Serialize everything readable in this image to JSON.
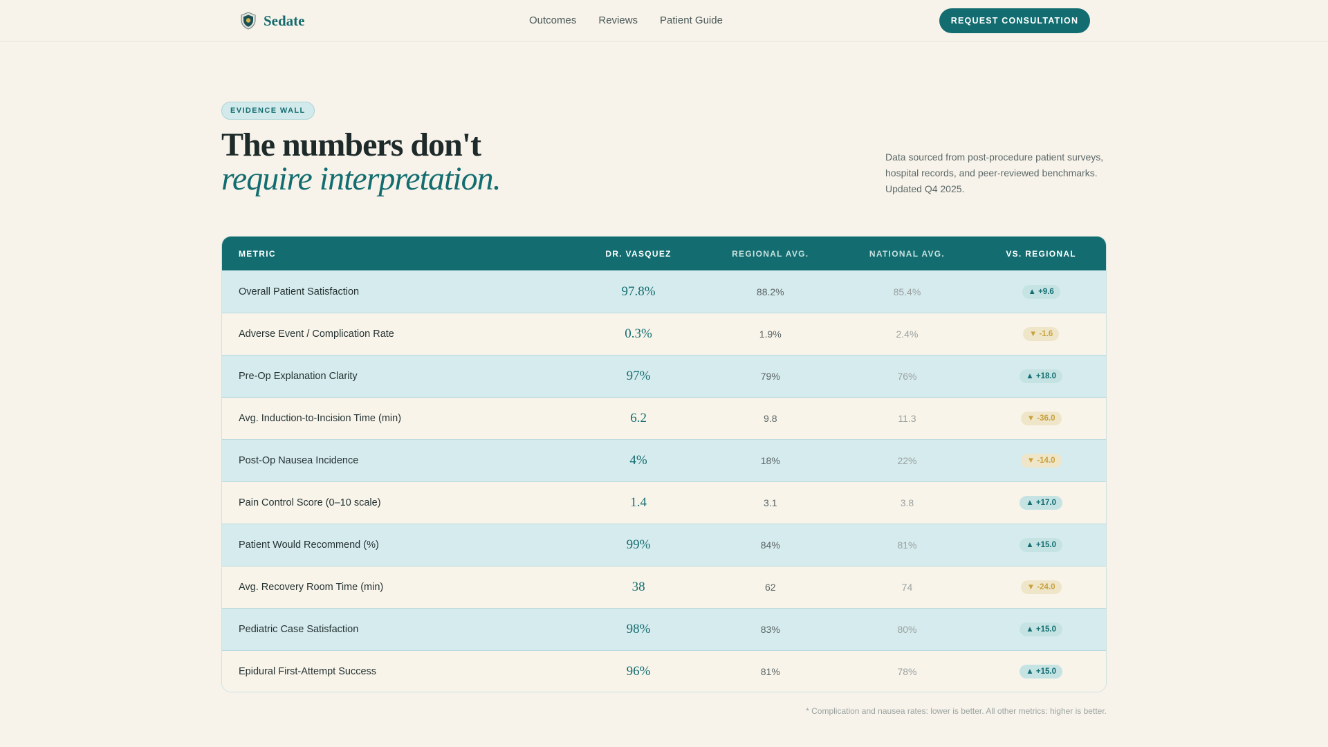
{
  "nav": {
    "brand": "Sedate",
    "links": [
      "Outcomes",
      "Reviews",
      "Patient Guide"
    ],
    "cta": "REQUEST CONSULTATION",
    "brand_icon": "shield-icon"
  },
  "hero": {
    "badge": "EVIDENCE WALL",
    "headline": "The numbers don't",
    "headline_italic": "require interpretation.",
    "source_note": "Data sourced from post-procedure patient surveys, hospital records, and peer-reviewed benchmarks. Updated Q4 2025."
  },
  "table": {
    "headers": [
      "METRIC",
      "DR. VASQUEZ",
      "REGIONAL AVG.",
      "NATIONAL AVG.",
      "VS. REGIONAL"
    ],
    "rows": [
      {
        "metric": "Overall Patient Satisfaction",
        "dr": "97.8%",
        "regional": "88.2%",
        "national": "85.4%",
        "vs": "▲ +9.6",
        "direction": "up"
      },
      {
        "metric": "Adverse Event / Complication Rate",
        "dr": "0.3%",
        "regional": "1.9%",
        "national": "2.4%",
        "vs": "▼ -1.6",
        "direction": "down"
      },
      {
        "metric": "Pre-Op Explanation Clarity",
        "dr": "97%",
        "regional": "79%",
        "national": "76%",
        "vs": "▲ +18.0",
        "direction": "up"
      },
      {
        "metric": "Avg. Induction-to-Incision Time (min)",
        "dr": "6.2",
        "regional": "9.8",
        "national": "11.3",
        "vs": "▼ -36.0",
        "direction": "down"
      },
      {
        "metric": "Post-Op Nausea Incidence",
        "dr": "4%",
        "regional": "18%",
        "national": "22%",
        "vs": "▼ -14.0",
        "direction": "down"
      },
      {
        "metric": "Pain Control Score (0–10 scale)",
        "dr": "1.4",
        "regional": "3.1",
        "national": "3.8",
        "vs": "▲ +17.0",
        "direction": "up"
      },
      {
        "metric": "Patient Would Recommend (%)",
        "dr": "99%",
        "regional": "84%",
        "national": "81%",
        "vs": "▲ +15.0",
        "direction": "up"
      },
      {
        "metric": "Avg. Recovery Room Time (min)",
        "dr": "38",
        "regional": "62",
        "national": "74",
        "vs": "▼ -24.0",
        "direction": "down"
      },
      {
        "metric": "Pediatric Case Satisfaction",
        "dr": "98%",
        "regional": "83%",
        "national": "80%",
        "vs": "▲ +15.0",
        "direction": "up"
      },
      {
        "metric": "Epidural First-Attempt Success",
        "dr": "96%",
        "regional": "81%",
        "national": "78%",
        "vs": "▲ +15.0",
        "direction": "up"
      }
    ]
  },
  "footnote": "* Complication and nausea rates: lower is better. All other metrics: higher is better.",
  "colors": {
    "accent": "#136d70",
    "background": "#f7f3ea",
    "row_alt": "#d6ebee",
    "up": "#136d70",
    "down": "#c8a23c"
  }
}
